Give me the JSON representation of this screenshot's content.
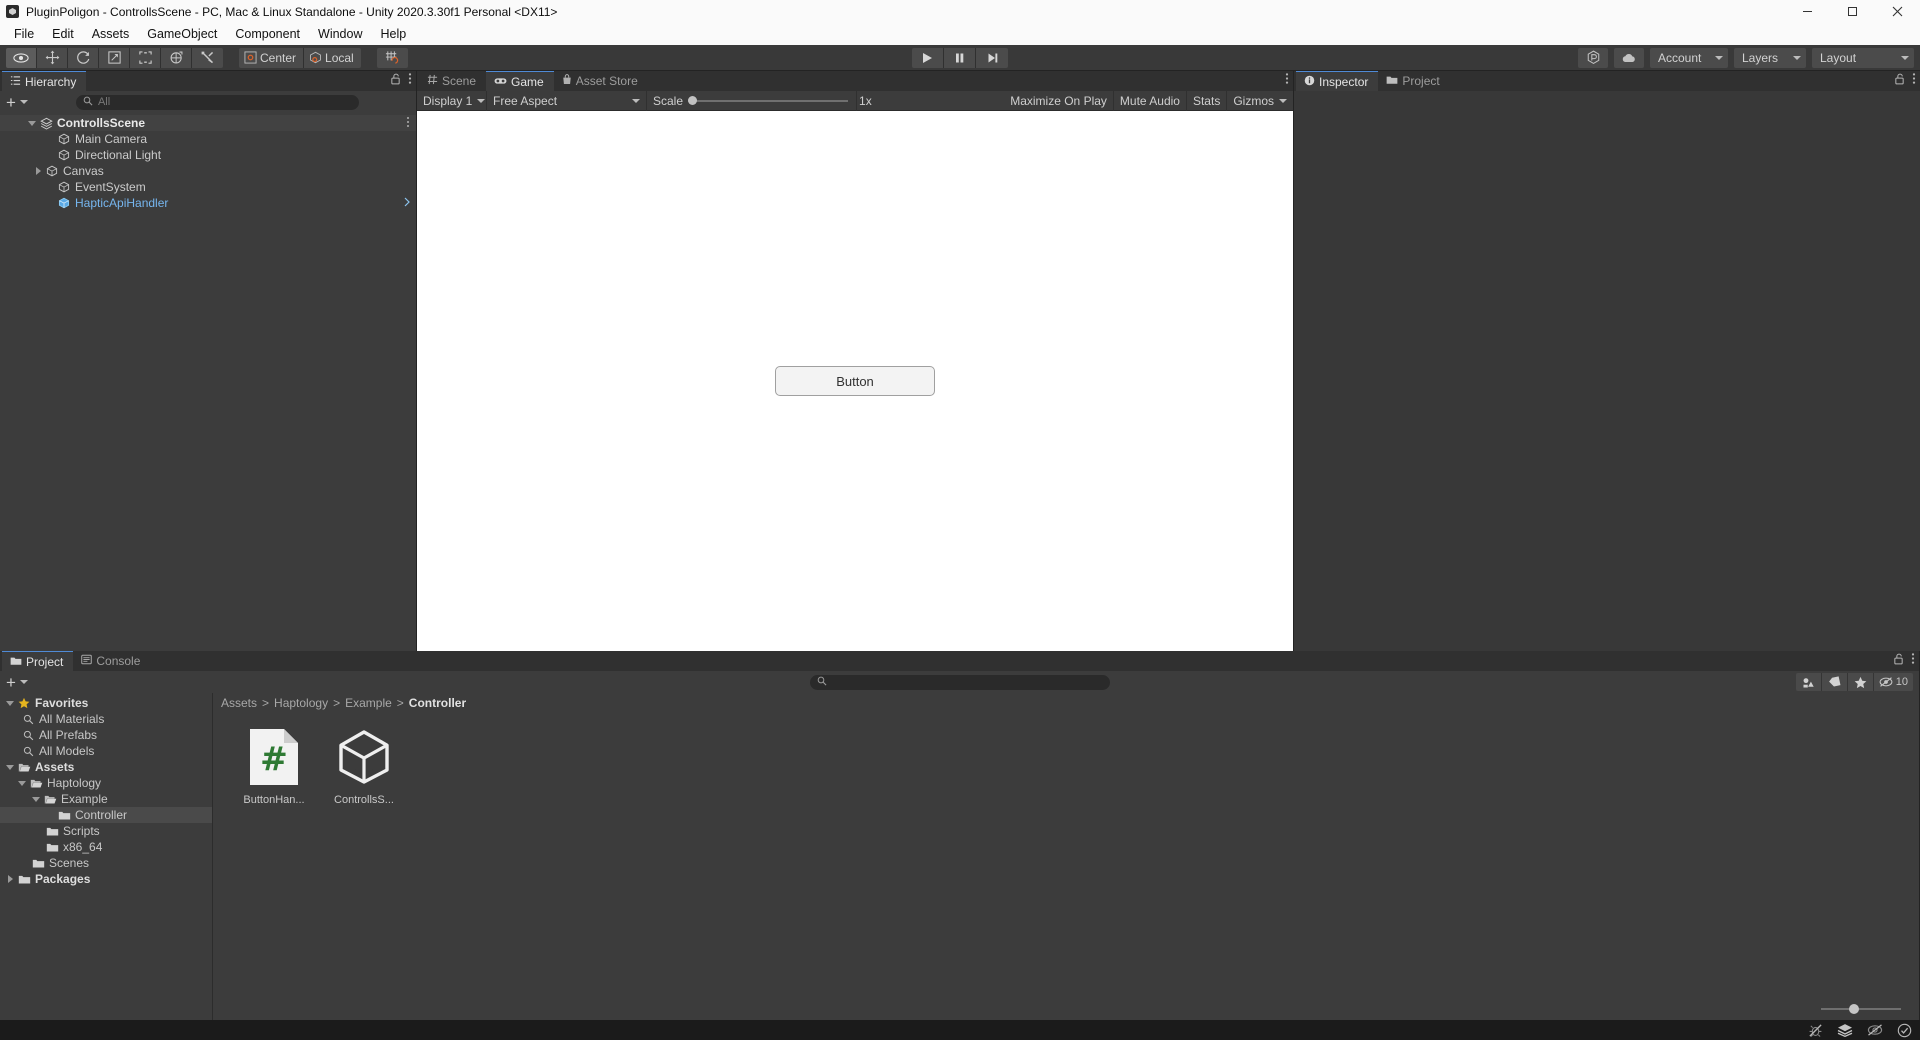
{
  "window": {
    "title": "PluginPoligon - ControllsScene - PC, Mac & Linux Standalone - Unity 2020.3.30f1 Personal <DX11>",
    "app_icon": "unity-icon",
    "minimize_label": "minimize-icon",
    "maximize_label": "maximize-icon",
    "close_label": "close-icon"
  },
  "menubar": {
    "items": [
      {
        "label": "File"
      },
      {
        "label": "Edit"
      },
      {
        "label": "Assets"
      },
      {
        "label": "GameObject"
      },
      {
        "label": "Component"
      },
      {
        "label": "Window"
      },
      {
        "label": "Help"
      }
    ]
  },
  "toolbar": {
    "tools": [
      {
        "name": "hand-tool",
        "active": true
      },
      {
        "name": "move-tool",
        "active": false
      },
      {
        "name": "rotate-tool",
        "active": false
      },
      {
        "name": "scale-tool",
        "active": false
      },
      {
        "name": "rect-transform-tool",
        "active": false
      },
      {
        "name": "transform-tool",
        "active": false
      },
      {
        "name": "custom-editor-tool",
        "active": false
      }
    ],
    "pivot_mode": "Center",
    "pivot_rotation": "Local",
    "grid_snap_icon": "grid-snap-icon",
    "playback": [
      {
        "name": "play-button",
        "icon": "play-icon"
      },
      {
        "name": "pause-button",
        "icon": "pause-icon"
      },
      {
        "name": "step-button",
        "icon": "step-icon"
      }
    ],
    "right": {
      "collab_icon": "plastic-scm-icon",
      "cloud_icon": "cloud-icon",
      "account_label": "Account",
      "layers_label": "Layers",
      "layout_label": "Layout"
    }
  },
  "hierarchy": {
    "tab_label": "Hierarchy",
    "tab_icon": "hierarchy-icon",
    "lock_icon": "lock-open-icon",
    "menu_icon": "kebab-menu-icon",
    "add_label": "+",
    "search_placeholder": "All",
    "search_value": "",
    "items": [
      {
        "label": "ControllsScene",
        "depth": 0,
        "twirl": "down",
        "icon": "scene-icon",
        "kind": "scene"
      },
      {
        "label": "Main Camera",
        "depth": 1,
        "twirl": "none",
        "icon": "gameobject-icon",
        "kind": "object"
      },
      {
        "label": "Directional Light",
        "depth": 1,
        "twirl": "none",
        "icon": "gameobject-icon",
        "kind": "object"
      },
      {
        "label": "Canvas",
        "depth": 1,
        "twirl": "right",
        "icon": "gameobject-icon",
        "kind": "object"
      },
      {
        "label": "EventSystem",
        "depth": 1,
        "twirl": "none",
        "icon": "gameobject-icon",
        "kind": "object"
      },
      {
        "label": "HapticApiHandler",
        "depth": 1,
        "twirl": "none",
        "icon": "prefab-icon",
        "kind": "prefab"
      }
    ]
  },
  "center": {
    "tabs": [
      {
        "label": "Scene",
        "icon": "scene-grid-icon",
        "active": false
      },
      {
        "label": "Game",
        "icon": "game-pad-icon",
        "active": true
      },
      {
        "label": "Asset Store",
        "icon": "asset-store-icon",
        "active": false
      }
    ],
    "menu_icon": "kebab-menu-icon",
    "gameview_toolbar": {
      "display": "Display 1",
      "aspect": "Free Aspect",
      "scale_label": "Scale",
      "scale_value": "1x",
      "maximize_on_play": "Maximize On Play",
      "mute_audio": "Mute Audio",
      "stats": "Stats",
      "gizmos": "Gizmos"
    },
    "gameview": {
      "background_color": "#ffffff",
      "button_label": "Button"
    }
  },
  "inspector": {
    "tabs": [
      {
        "label": "Inspector",
        "icon": "info-icon",
        "active": true
      },
      {
        "label": "Project",
        "icon": "folder-icon",
        "active": false
      }
    ],
    "lock_icon": "lock-open-icon",
    "menu_icon": "kebab-menu-icon"
  },
  "project": {
    "tabs": [
      {
        "label": "Project",
        "icon": "folder-icon",
        "active": true
      },
      {
        "label": "Console",
        "icon": "console-icon",
        "active": false
      }
    ],
    "lock_icon": "lock-open-icon",
    "menu_icon": "kebab-menu-icon",
    "add_label": "+",
    "search_placeholder": "",
    "search_value": "",
    "filters": [
      {
        "name": "asset-type-filter-icon"
      },
      {
        "name": "label-filter-icon"
      },
      {
        "name": "favorite-filter-icon"
      },
      {
        "name": "hidden-packages-icon",
        "count": "10"
      }
    ],
    "tree": [
      {
        "label": "Favorites",
        "depth": 0,
        "twirl": "down",
        "icon": "star-icon",
        "bold": true,
        "selected": false
      },
      {
        "label": "All Materials",
        "depth": 1,
        "twirl": "none",
        "icon": "search-icon",
        "bold": false,
        "selected": false
      },
      {
        "label": "All Prefabs",
        "depth": 1,
        "twirl": "none",
        "icon": "search-icon",
        "bold": false,
        "selected": false
      },
      {
        "label": "All Models",
        "depth": 1,
        "twirl": "none",
        "icon": "search-icon",
        "bold": false,
        "selected": false
      },
      {
        "label": "Assets",
        "depth": 0,
        "twirl": "down",
        "icon": "folder-open-icon",
        "bold": true,
        "selected": false
      },
      {
        "label": "Haptology",
        "depth": 1,
        "twirl": "down",
        "icon": "folder-open-icon",
        "bold": false,
        "selected": false
      },
      {
        "label": "Example",
        "depth": 2,
        "twirl": "down",
        "icon": "folder-open-icon",
        "bold": false,
        "selected": false
      },
      {
        "label": "Controller",
        "depth": 3,
        "twirl": "none",
        "icon": "folder-icon",
        "bold": false,
        "selected": true
      },
      {
        "label": "Scripts",
        "depth": 2,
        "twirl": "none",
        "icon": "folder-icon",
        "bold": false,
        "selected": false
      },
      {
        "label": "x86_64",
        "depth": 2,
        "twirl": "none",
        "icon": "folder-icon",
        "bold": false,
        "selected": false
      },
      {
        "label": "Scenes",
        "depth": 1,
        "twirl": "none",
        "icon": "folder-icon",
        "bold": false,
        "selected": false
      },
      {
        "label": "Packages",
        "depth": 0,
        "twirl": "right",
        "icon": "folder-icon",
        "bold": true,
        "selected": false
      }
    ],
    "breadcrumb": [
      "Assets",
      "Haptology",
      "Example",
      "Controller"
    ],
    "assets": [
      {
        "label": "ButtonHan...",
        "icon": "csharp-script-icon"
      },
      {
        "label": "ControllsS...",
        "icon": "unity-scene-icon"
      }
    ]
  },
  "statusbar": {
    "icons": [
      {
        "name": "debug-bug-muted-icon"
      },
      {
        "name": "layers-stack-icon"
      },
      {
        "name": "preview-eye-muted-icon"
      },
      {
        "name": "check-circle-icon"
      }
    ]
  },
  "colors": {
    "accent": "#4f8ad6",
    "panel": "#3c3c3c",
    "panel_dark": "#303030",
    "toolbar": "#393939",
    "titlebar": "#fafafa",
    "prefab_blue": "#76b6ef",
    "script_green": "#2f7a34"
  }
}
